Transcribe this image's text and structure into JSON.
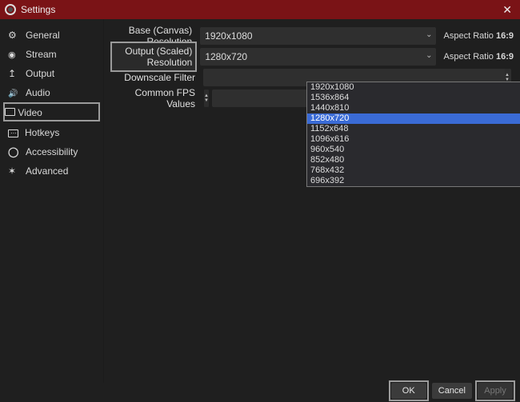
{
  "window": {
    "title": "Settings"
  },
  "sidebar": {
    "items": [
      {
        "label": "General"
      },
      {
        "label": "Stream"
      },
      {
        "label": "Output"
      },
      {
        "label": "Audio"
      },
      {
        "label": "Video"
      },
      {
        "label": "Hotkeys"
      },
      {
        "label": "Accessibility"
      },
      {
        "label": "Advanced"
      }
    ],
    "selected_index": 4
  },
  "video": {
    "base_label": "Base (Canvas) Resolution",
    "base_value": "1920x1080",
    "base_aspect_prefix": "Aspect Ratio ",
    "base_aspect_value": "16:9",
    "output_label": "Output (Scaled) Resolution",
    "output_value": "1280x720",
    "output_aspect_prefix": "Aspect Ratio ",
    "output_aspect_value": "16:9",
    "downscale_label": "Downscale Filter",
    "fps_label": "Common FPS Values",
    "output_options": [
      "1920x1080",
      "1536x864",
      "1440x810",
      "1280x720",
      "1152x648",
      "1096x616",
      "960x540",
      "852x480",
      "768x432",
      "696x392"
    ],
    "output_selected_index": 3
  },
  "footer": {
    "ok": "OK",
    "cancel": "Cancel",
    "apply": "Apply"
  }
}
